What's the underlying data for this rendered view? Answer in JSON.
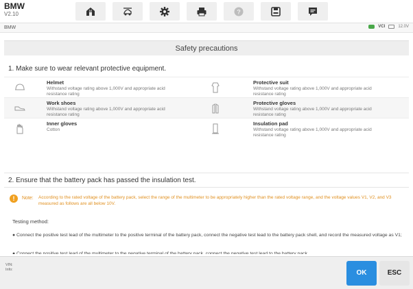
{
  "app": {
    "name": "BMW",
    "version": "V2.10"
  },
  "toolbar": {
    "items": [
      {
        "icon": "home-icon"
      },
      {
        "icon": "vehicle-lift-icon"
      },
      {
        "icon": "gear-icon"
      },
      {
        "icon": "printer-icon"
      },
      {
        "icon": "help-icon"
      },
      {
        "icon": "save-icon"
      },
      {
        "icon": "chat-icon"
      }
    ]
  },
  "statusbar": {
    "path": "BMW",
    "vci": "VCI",
    "voltage": "12.0V"
  },
  "panel": {
    "title": "Safety precautions"
  },
  "section1": {
    "heading": "1. Make sure to wear relevant protective equipment."
  },
  "equipment": [
    {
      "title": "Helmet",
      "desc": "Withstand voltage rating above 1,000V and appropriate acid resistance rating",
      "icon": "helmet-icon"
    },
    {
      "title": "Protective suit",
      "desc": "Withstand voltage rating above 1,000V and appropriate acid resistance rating",
      "icon": "protective-suit-icon"
    },
    {
      "title": "Work shoes",
      "desc": "Withstand voltage rating above 1,000V and appropriate acid resistance rating",
      "icon": "work-shoes-icon"
    },
    {
      "title": "Protective gloves",
      "desc": "Withstand voltage rating above 1,000V and appropriate acid resistance rating",
      "icon": "protective-gloves-icon"
    },
    {
      "title": "Inner gloves",
      "desc": "Cotton",
      "icon": "inner-gloves-icon"
    },
    {
      "title": "Insulation pad",
      "desc": "Withstand voltage rating above 1,000V and appropriate acid resistance rating",
      "icon": "insulation-pad-icon"
    }
  ],
  "section2": {
    "heading": "2. Ensure that the battery pack has passed the insulation test."
  },
  "note": {
    "label": "Note:",
    "text": "According to the rated voltage of the battery pack, select the range of the multimeter to be appropriately higher than the rated voltage range, and the voltage values V1, V2, and V3 measured as follows are all below 10V."
  },
  "testing": {
    "label": "Testing method:",
    "step1": "● Connect the positive test lead of the multimeter to the positive terminal of the battery pack, connect the negative test lead to the battery pack shell, and record the measured voltage as V1;",
    "step2": "● Connect the positive test lead of the multimeter to the negative terminal of the battery pack, connect the negative test lead to the battery pack"
  },
  "footer": {
    "vin": "VIN:",
    "info": "Info:",
    "ok": "OK",
    "esc": "ESC"
  },
  "colors": {
    "accent": "#2a8ee0",
    "warning": "#e09020"
  }
}
